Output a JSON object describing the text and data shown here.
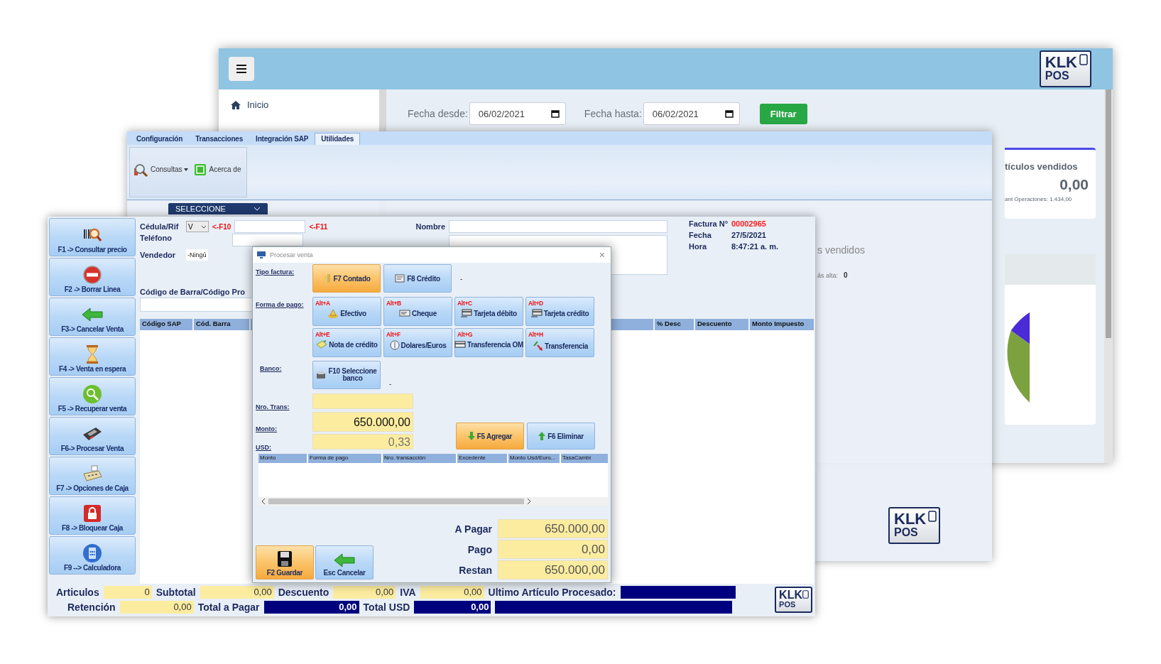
{
  "dashboard": {
    "sidebar": {
      "items": [
        {
          "label": "Inicio"
        }
      ]
    },
    "filters": [
      {
        "label": "Fecha desde:",
        "value": "06/02/2021"
      },
      {
        "label": "Fecha hasta:",
        "value": "06/02/2021"
      }
    ],
    "filter_button": "Filtrar",
    "stat_card": {
      "title": "tículos vendidos",
      "value": "0,00",
      "note": "ant Operaciones: 1.434,00"
    },
    "logo": {
      "line_1": "KLK",
      "line_2": "POS"
    }
  },
  "back_office": {
    "tabs": [
      {
        "label": "Configuración",
        "selected": false
      },
      {
        "label": "Transacciones",
        "selected": false
      },
      {
        "label": "Integración SAP",
        "selected": false
      },
      {
        "label": "Utilidades",
        "selected": true
      }
    ],
    "toolbar": [
      {
        "label": "Consultas",
        "dropdown": true
      },
      {
        "label": "Acerca de",
        "dropdown": false
      }
    ],
    "select": "SELECCIONE",
    "caption": "s vendidos",
    "stat": {
      "label": "ás alta:",
      "value": "0"
    },
    "logo": {
      "line_1": "KLK",
      "line_2": "POS"
    }
  },
  "pos": {
    "function_keys": [
      {
        "label": "F1 -> Consultar precio"
      },
      {
        "label": "F2 -> Borrar Linea"
      },
      {
        "label": "F3-> Cancelar Venta"
      },
      {
        "label": "F4 -> Venta en espera"
      },
      {
        "label": "F5 -> Recuperar venta"
      },
      {
        "label": "F6-> Procesar Venta"
      },
      {
        "label": "F7 -> Opciones de Caja"
      },
      {
        "label": "F8 -> Bloquear Caja"
      },
      {
        "label": "F9 --> Calculadora"
      }
    ],
    "id_label": "Cédula/Rif",
    "id_type": "V",
    "id_hotkey": "<-F10",
    "name_hotkey": "<-F11",
    "name_label": "Nombre",
    "phone_label": "Teléfono",
    "seller_label": "Vendedor",
    "seller_value": "-Ningú",
    "invoice": [
      {
        "label": "Factura N°",
        "value": "00002965",
        "color": "#ff1a1a"
      },
      {
        "label": "Fecha",
        "value": "27/5/2021",
        "color": "#1b2a5c"
      },
      {
        "label": "Hora",
        "value": "8:47:21 a. m.",
        "color": "#1b2a5c"
      }
    ],
    "barcode_label": "Código de Barra/Código Pro",
    "columns_left": [
      "Código SAP",
      "Cód. Barra"
    ],
    "columns_right": [
      "% Desc",
      "Descuento",
      "Monto Impuesto"
    ],
    "totals_row_1": [
      {
        "label": "Articulos",
        "value": "0",
        "kind": "yellow"
      },
      {
        "label": "Subtotal",
        "value": "0,00",
        "kind": "yellow"
      },
      {
        "label": "Descuento",
        "value": "0,00",
        "kind": "yellow"
      },
      {
        "label": "IVA",
        "value": "0,00",
        "kind": "yellow"
      },
      {
        "label": "Ultimo Artículo Procesado:",
        "kind": "navy"
      }
    ],
    "totals_row_2": [
      {
        "label": "Retención",
        "value": "0,00",
        "kind": "yellow"
      },
      {
        "label": "Total a Pagar",
        "value": "0,00",
        "kind": "navy"
      },
      {
        "label": "Total USD",
        "value": "0,00",
        "kind": "navy"
      },
      {
        "kind": "navy"
      }
    ],
    "logo": {
      "line_1": "KLK",
      "line_2": "POS"
    }
  },
  "dialog": {
    "title": "Procesar venta",
    "close": "×",
    "invoice_type_label": "Tipo factura:",
    "invoice_types": [
      {
        "label": "F7 Contado",
        "selected": true
      },
      {
        "label": "F8 Crédito",
        "selected": false
      }
    ],
    "invoice_type_value": "-",
    "payment_label": "Forma de pago:",
    "payment_methods": [
      {
        "hotkey": "Alt+A",
        "label": "Efectivo"
      },
      {
        "hotkey": "Alt+B",
        "label": "Cheque"
      },
      {
        "hotkey": "Alt+C",
        "label": "Tarjeta débito"
      },
      {
        "hotkey": "Alt+D",
        "label": "Tarjeta crédito"
      },
      {
        "hotkey": "Alt+E",
        "label": "Nota de crédito"
      },
      {
        "hotkey": "Alt+F",
        "label": "Dolares/Euros"
      },
      {
        "hotkey": "Alt+G",
        "label": "Transferencia OM"
      },
      {
        "hotkey": "Alt+H",
        "label": "Transferencia"
      }
    ],
    "bank_label": "Banco:",
    "bank_button": "F10 Seleccione banco",
    "bank_value": "-",
    "trans_label": "Nro. Trans:",
    "amount_label": "Monto:",
    "amount": "650.000,00",
    "usd_label": "USD:",
    "usd": "0,33",
    "actions": [
      {
        "label": "F5 Agregar",
        "highlighted": true
      },
      {
        "label": "F6 Eliminar",
        "highlighted": false
      }
    ],
    "columns": [
      "Monto",
      "Forma de pago",
      "Nro. transacción",
      "Excedente",
      "Monto Usd/Euro...",
      "TasaCambi"
    ],
    "summary": [
      {
        "label": "A Pagar",
        "value": "650.000,00"
      },
      {
        "label": "Pago",
        "value": "0,00"
      },
      {
        "label": "Restan",
        "value": "650.000,00"
      }
    ],
    "footer_buttons": [
      {
        "label": "F2 Guardar",
        "highlighted": true
      },
      {
        "label": "Esc Cancelar",
        "highlighted": false
      }
    ]
  }
}
